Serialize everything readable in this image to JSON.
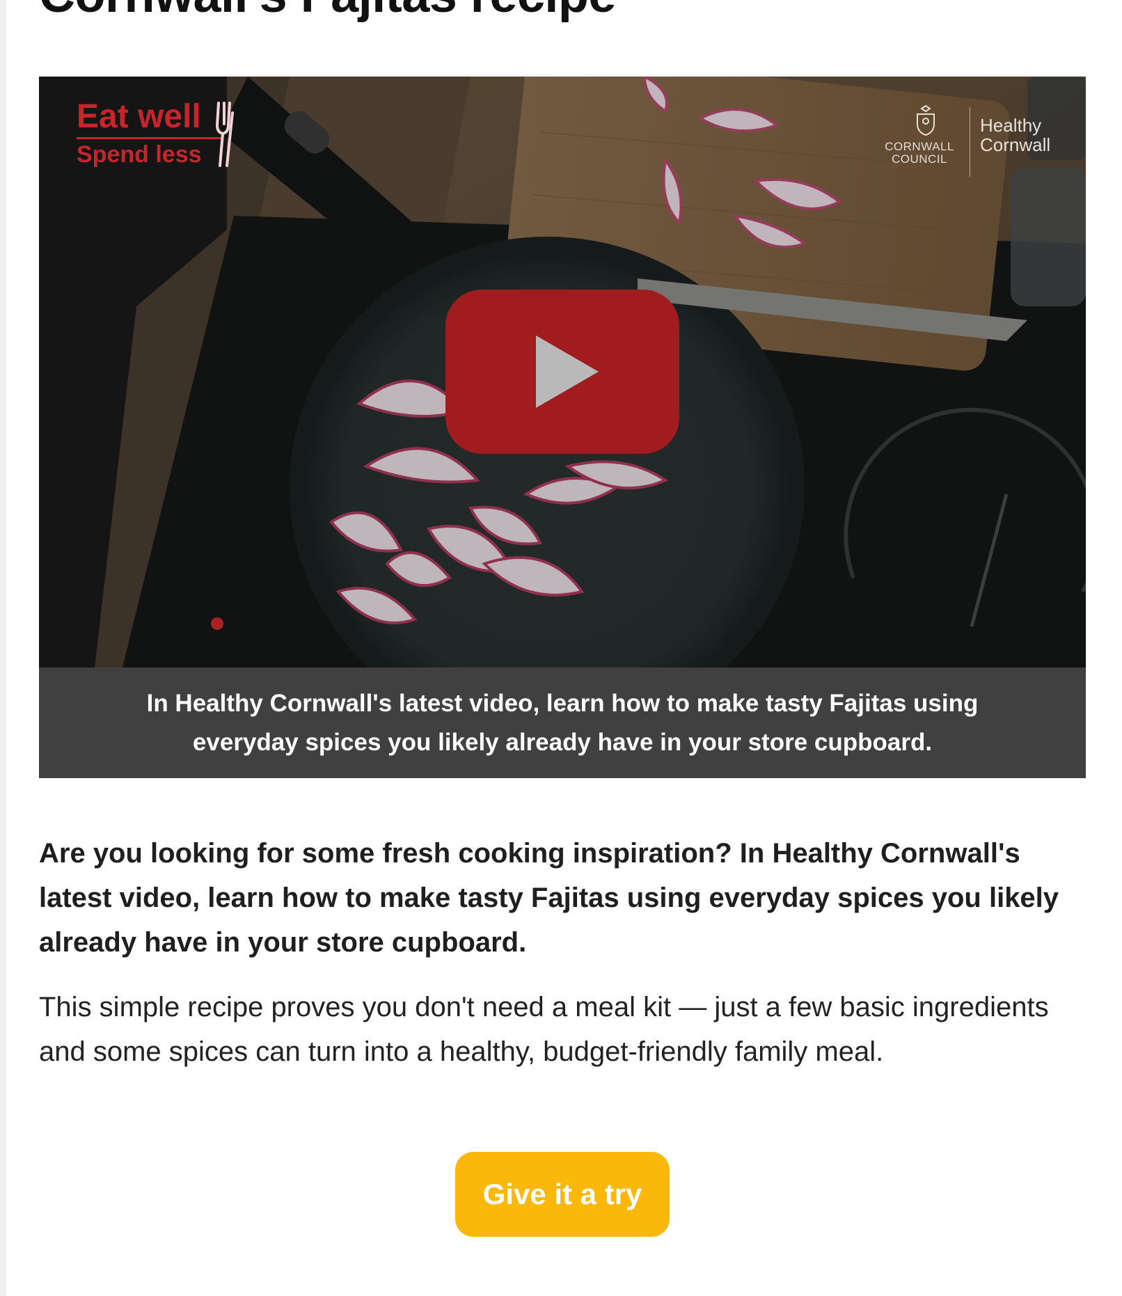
{
  "page": {
    "title": "Cornwall's Fajitas recipe"
  },
  "video": {
    "thumbnail_overlay": {
      "brand_line_1": "Eat well",
      "brand_line_2": "Spend less",
      "council_name": "CORNWALL COUNCIL",
      "partner_name": "Healthy Cornwall"
    },
    "play_icon": "play-icon",
    "caption": "In Healthy Cornwall's latest video, learn how to make tasty Fajitas using everyday spices you likely already have in your store cupboard."
  },
  "article": {
    "lead": "Are you looking for some fresh cooking inspiration? In Healthy Cornwall's latest video, learn how to make tasty Fajitas using everyday spices you likely already have in your store cupboard.",
    "body": "This simple recipe proves you don't need a meal kit — just a few basic ingredients and some spices can turn into a healthy, budget-friendly family meal."
  },
  "cta": {
    "label": "Give it a try"
  },
  "colors": {
    "cta_background": "#fbb80a",
    "caption_background": "#404040",
    "play_button": "#a11c1f",
    "brand_red": "#c8242c"
  }
}
